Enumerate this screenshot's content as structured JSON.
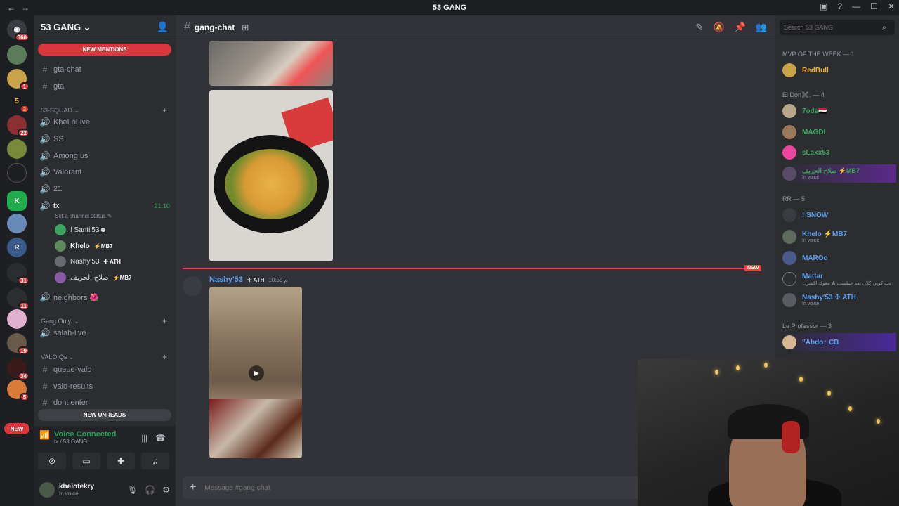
{
  "window": {
    "title": "53 GANG"
  },
  "server": {
    "name": "53 GANG ⌄",
    "mentions_pill": "NEW MENTIONS",
    "unreads_pill": "NEW UNREADS"
  },
  "rail": {
    "badges": [
      "360",
      "1",
      "2",
      "22",
      "",
      "",
      "",
      "",
      "",
      "",
      "31",
      "11",
      "",
      "19",
      "34",
      "5"
    ],
    "new_label": "NEW"
  },
  "channels": {
    "items_top": [
      {
        "icon": "#",
        "label": "gta-chat"
      },
      {
        "icon": "#",
        "label": "gta"
      }
    ],
    "cat_squad": "53-SQUAD ⌄",
    "squad_items": [
      {
        "label": "KheLoLive"
      },
      {
        "label": "SS"
      },
      {
        "label": "Among us"
      },
      {
        "label": "Valorant"
      },
      {
        "label": "21"
      }
    ],
    "tx": {
      "label": "tx",
      "time": "21:10",
      "status": "Set a channel status ✎"
    },
    "voice_users": [
      {
        "name": "! Santi'53☻",
        "tag": "",
        "color": "#3ba55d"
      },
      {
        "name": "Khelo",
        "tag": "⚡MB7",
        "color": "#5e8a5e"
      },
      {
        "name": "Nashy'53",
        "tag": "✢ ATH",
        "color": "#6a6a72"
      },
      {
        "name": "صلاح الحريف",
        "tag": "⚡MB7",
        "color": "#8a5aa8"
      }
    ],
    "neighbors": "neighbors 🌺",
    "cat_gang": "Gang Only. ⌄",
    "gang_items": [
      {
        "label": "salah-live"
      }
    ],
    "cat_valo": "VALO Qs ⌄",
    "valo_items": [
      {
        "label": "queue-valo"
      },
      {
        "label": "valo-results"
      },
      {
        "label": "dont enter"
      }
    ]
  },
  "voice_panel": {
    "status": "Voice Connected",
    "location": "tx / 53 GANG"
  },
  "user": {
    "name": "khelofekry",
    "status": "In voice"
  },
  "chat": {
    "channel": "gang-chat",
    "new_label": "NEW",
    "message": {
      "author": "Nashy'53",
      "tag": "✢ ATH",
      "time": "10:55 م"
    },
    "composer_placeholder": "Message #gang-chat"
  },
  "members": {
    "search_placeholder": "Search 53 GANG",
    "groups": [
      {
        "title": "MVP OF THE WEEK — 1",
        "members": [
          {
            "name": "RedBull",
            "color": "#f0b232",
            "sub": ""
          }
        ]
      },
      {
        "title": "El Don✖️. — 4",
        "members": [
          {
            "name": "7oda🇪🇬",
            "color": "#3ba55d",
            "sub": ""
          },
          {
            "name": "MAGDI",
            "color": "#3ba55d",
            "sub": ""
          },
          {
            "name": "sLaxx53",
            "color": "#3ba55d",
            "sub": ""
          },
          {
            "name": "صلاح الحريف ⚡MB7",
            "color": "#3ba55d",
            "sub": "In voice"
          }
        ]
      },
      {
        "title": "RR — 5",
        "members": [
          {
            "name": "! SNOW",
            "color": "#5aa0f0",
            "sub": ""
          },
          {
            "name": "Khelo ⚡MB7",
            "color": "#5aa0f0",
            "sub": "In voice"
          },
          {
            "name": "MAROo",
            "color": "#5aa0f0",
            "sub": ""
          },
          {
            "name": "Mattar",
            "color": "#5aa0f0",
            "sub": "...حطست كوبي كلان بعد خطست بلا معوك اكشر"
          },
          {
            "name": "Nashy'53 ✢ ATH",
            "color": "#5aa0f0",
            "sub": "In voice"
          }
        ]
      },
      {
        "title": "Le Professor — 3",
        "members": [
          {
            "name": "\"Abdo↑ CB",
            "color": "#5aa0f0",
            "sub": ""
          }
        ]
      }
    ]
  },
  "colors": {
    "accent_red": "#da373c",
    "online_green": "#23a559",
    "link_blue": "#5aa0f0"
  }
}
